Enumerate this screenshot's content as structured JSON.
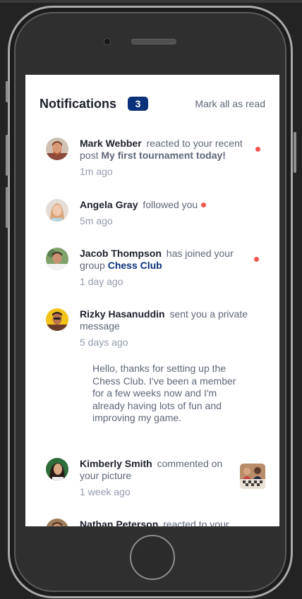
{
  "header": {
    "title": "Notifications",
    "unread_count": "3",
    "mark_all_label": "Mark all as read"
  },
  "notifications": [
    {
      "name": "Mark Webber",
      "action": "reacted to your recent post",
      "target": "My first tournament today!",
      "time": "1m ago",
      "unread": true
    },
    {
      "name": "Angela Gray",
      "action": "followed you",
      "time": "5m ago",
      "unread": true
    },
    {
      "name": "Jacob Thompson",
      "action": "has joined your group",
      "target": "Chess Club",
      "time": "1 day ago",
      "unread": true
    },
    {
      "name": "Rizky Hasanuddin",
      "action": "sent you a private message",
      "time": "5 days ago",
      "message": "Hello, thanks for setting up the Chess Club. I've been a member for a few weeks now and I'm already having lots of fun and improving my game.",
      "unread": false
    },
    {
      "name": "Kimberly Smith",
      "action": "commented on your picture",
      "time": "1 week ago",
      "unread": false
    },
    {
      "name": "Nathan Peterson",
      "action": "reacted to your",
      "unread": false
    }
  ],
  "colors": {
    "unread_dot": "#f65552",
    "badge_bg": "#0a327b",
    "group_link": "#0a327b"
  },
  "icons": {
    "avatar": "person-avatar",
    "thumbnail": "chess-picture-thumbnail"
  }
}
